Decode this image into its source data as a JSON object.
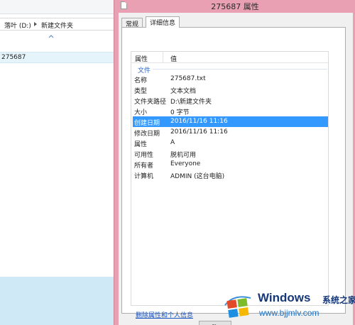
{
  "explorer": {
    "address": {
      "drive": "落叶 (D:)",
      "folder": "新建文件夹"
    },
    "selected_file": "275687"
  },
  "dialog": {
    "title": "275687 属性",
    "tabs": [
      {
        "label": "常规"
      },
      {
        "label": "详细信息"
      }
    ],
    "active_tab": "详细信息",
    "table": {
      "header": {
        "property": "属性",
        "value": "值"
      },
      "group": "文件",
      "rows": [
        {
          "key": "名称",
          "value": "275687.txt"
        },
        {
          "key": "类型",
          "value": "文本文档"
        },
        {
          "key": "文件夹路径",
          "value": "D:\\新建文件夹"
        },
        {
          "key": "大小",
          "value": "0 字节"
        },
        {
          "key": "创建日期",
          "value": "2016/11/16 11:16"
        },
        {
          "key": "修改日期",
          "value": "2016/11/16 11:16"
        },
        {
          "key": "属性",
          "value": "A"
        },
        {
          "key": "可用性",
          "value": "脱机可用"
        },
        {
          "key": "所有者",
          "value": "Everyone"
        },
        {
          "key": "计算机",
          "value": "ADMIN (这台电脑)"
        }
      ],
      "selected_row": "创建日期"
    },
    "remove_link": "删除属性和个人信息",
    "ok_label": "确"
  },
  "watermark": {
    "title": "Windows",
    "subtitle": "系统之家",
    "url": "www.bjjmlv.com"
  },
  "colors": {
    "titlebar": "#e8a0b2",
    "selection": "#3399ff",
    "link": "#1a54c0",
    "group_label": "#3366bb"
  }
}
